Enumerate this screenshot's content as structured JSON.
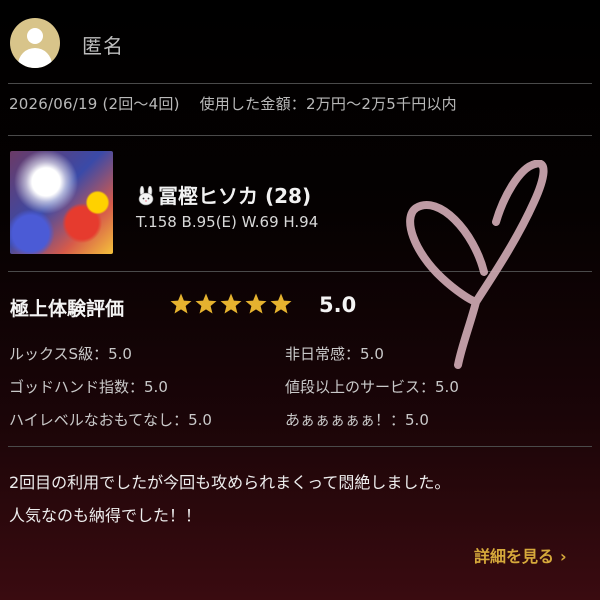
{
  "header": {
    "username": "匿名"
  },
  "meta": {
    "date": "2026/06/19",
    "visit_count": "(2回〜4回)",
    "spent_label": "使用した金額：",
    "spent_value": "2万円〜2万5千円以内"
  },
  "profile": {
    "name": "冨樫ヒソカ",
    "age": "(28)",
    "stats": "T.158 B.95(E) W.69 H.94",
    "rabbit_icon": "rabbit-icon"
  },
  "rating": {
    "title": "極上体験評価",
    "stars": 5,
    "stars_max": 5,
    "score": "5.0",
    "star_color": "#e5b22f",
    "criteria": [
      {
        "label": "ルックスS級：",
        "value": "5.0"
      },
      {
        "label": "非日常感：",
        "value": "5.0"
      },
      {
        "label": "ゴッドハンド指数：",
        "value": "5.0"
      },
      {
        "label": "値段以上のサービス：",
        "value": "5.0"
      },
      {
        "label": "ハイレベルなおもてなし：",
        "value": "5.0"
      },
      {
        "label": "あぁぁぁぁぁ！：",
        "value": "5.0"
      }
    ]
  },
  "comment": {
    "line1": "2回目の利用でしたが今回も攻められまくって悶絶しました。",
    "line2": "人気なのも納得でした！！"
  },
  "actions": {
    "more_label": "詳細を見る",
    "more_icon": "chevron-right-icon",
    "accent": "#d6a93b"
  },
  "decoration": {
    "heart_color": "#c8a3ad"
  }
}
